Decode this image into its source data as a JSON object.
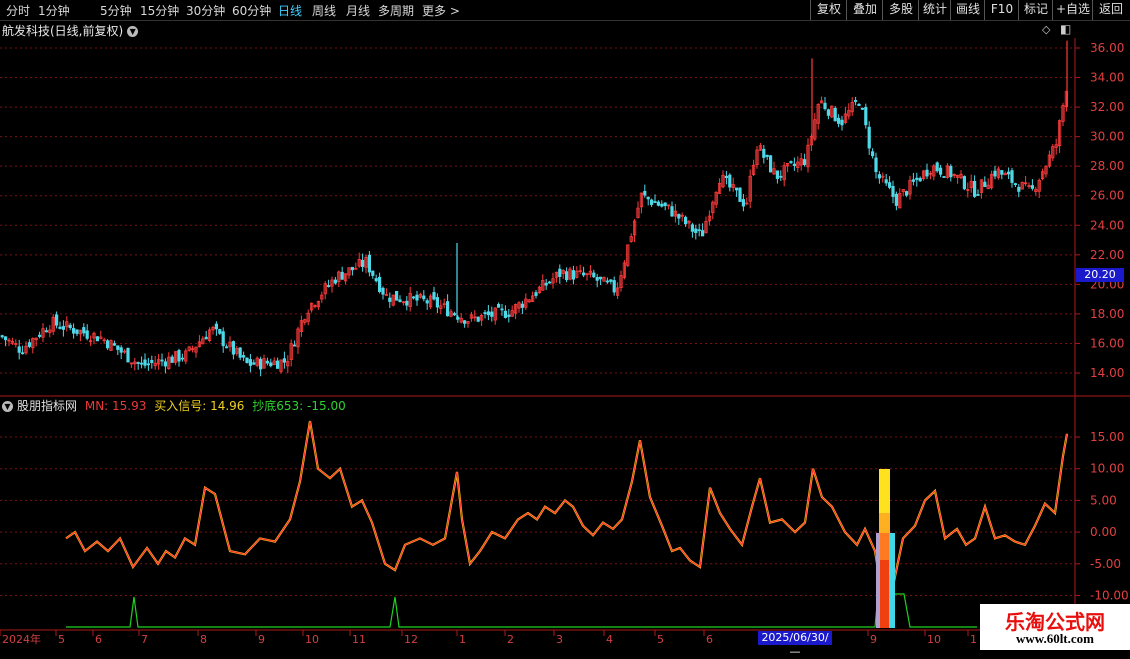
{
  "toolbar": {
    "periods": [
      "分时",
      "1分钟",
      "5分钟",
      "15分钟",
      "30分钟",
      "60分钟",
      "日线",
      "周线",
      "月线",
      "多周期",
      "更多"
    ],
    "active_period": "日线",
    "right_buttons": [
      "复权",
      "叠加",
      "多股",
      "统计",
      "画线",
      "F10",
      "标记",
      "+自选",
      "返回"
    ]
  },
  "main": {
    "title": "航发科技(日线,前复权)",
    "price_labels": [
      "36.00",
      "34.00",
      "32.00",
      "30.00",
      "28.00",
      "26.00",
      "24.00",
      "22.00",
      "20.00",
      "18.00",
      "16.00",
      "14.00"
    ],
    "current_price": "20.20"
  },
  "indicator": {
    "name": "股朋指标网",
    "items": [
      {
        "label": "MN: ",
        "value": "15.93",
        "color": "#e83a3a"
      },
      {
        "label": "买入信号: ",
        "value": "14.96",
        "color": "#f0d020"
      },
      {
        "label": "抄底653: ",
        "value": "-15.00",
        "color": "#30d030"
      }
    ],
    "axis_labels": [
      "15.00",
      "10.00",
      "5.00",
      "0.00",
      "-5.00",
      "-10.00"
    ]
  },
  "time_axis": {
    "labels": [
      "2024年",
      "5",
      "6",
      "7",
      "8",
      "9",
      "10",
      "11",
      "12",
      "1",
      "2",
      "3",
      "4",
      "5",
      "6",
      "9",
      "10",
      "1"
    ],
    "cursor_date": "2025/06/30/—"
  },
  "watermark": {
    "line1": "乐淘公式网",
    "line2": "www.60lt.com"
  },
  "colors": {
    "up": "#ff3b3b",
    "down": "#4fd8e8",
    "grid": "#7a1010",
    "axis": "#b01818",
    "mn": "#ff3030",
    "signal": "#ffc020",
    "bottom": "#20d020"
  }
}
